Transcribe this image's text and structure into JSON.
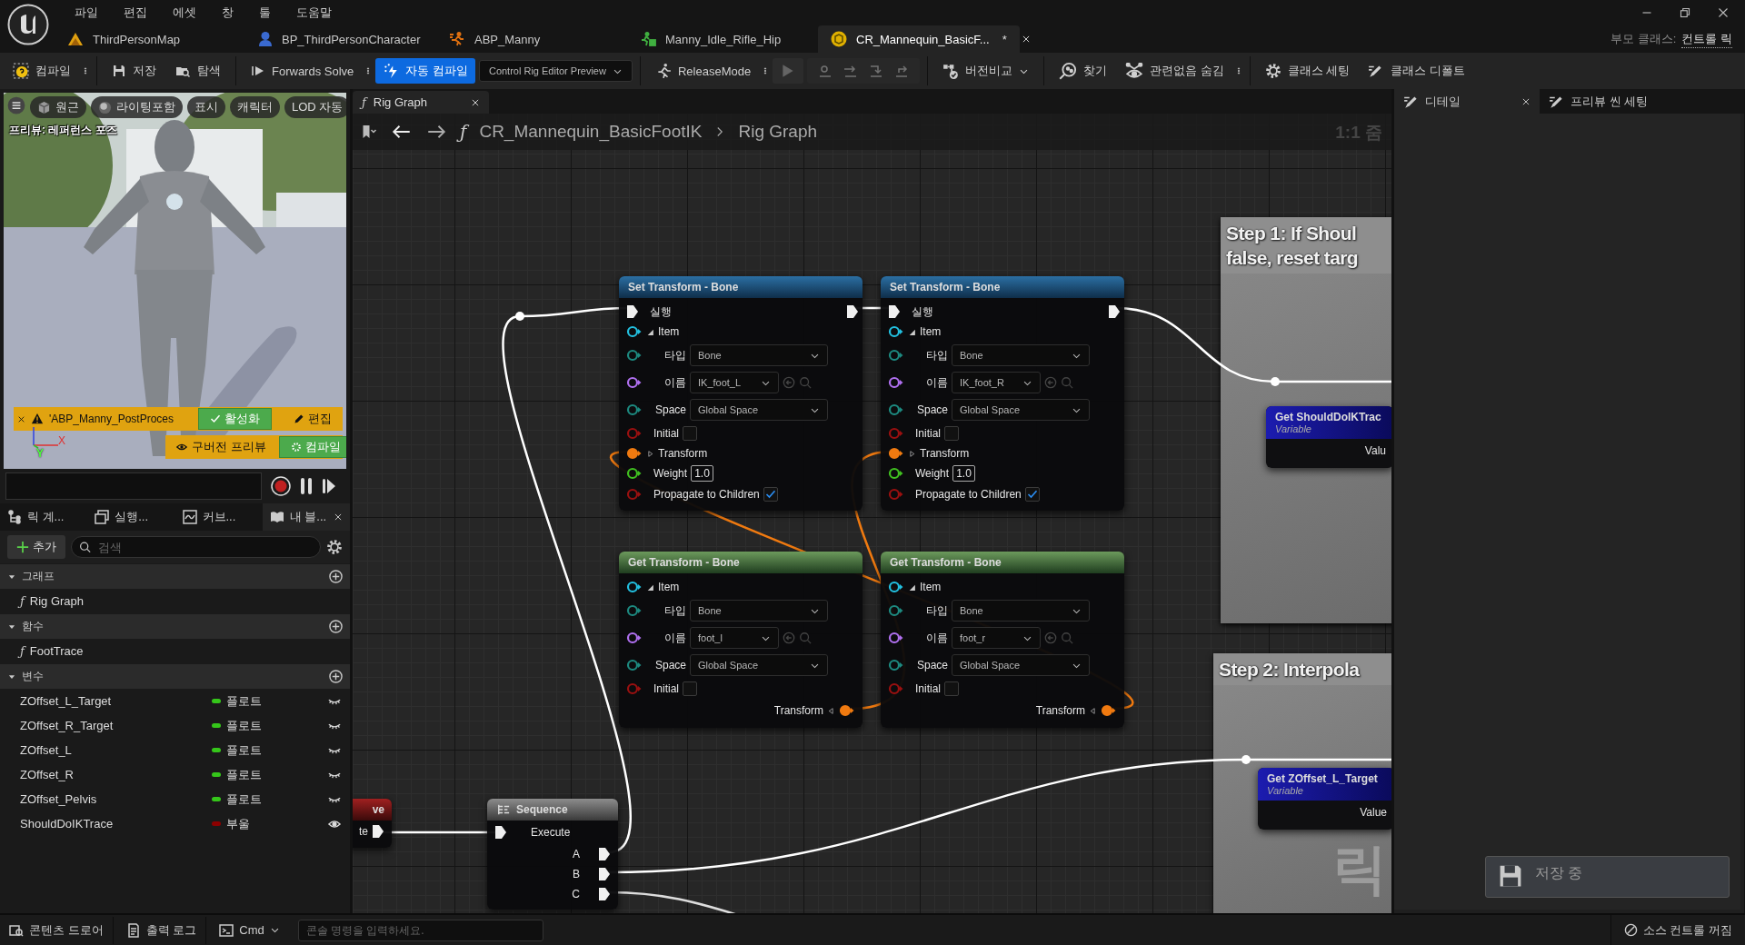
{
  "menu": [
    "파일",
    "편집",
    "에셋",
    "창",
    "툴",
    "도움말"
  ],
  "doc_tabs": [
    {
      "label": "ThirdPersonMap",
      "kind": "level",
      "selected": false,
      "closable": false
    },
    {
      "label": "BP_ThirdPersonCharacter",
      "kind": "blueprint",
      "selected": false,
      "closable": false
    },
    {
      "label": "ABP_Manny",
      "kind": "anim",
      "selected": false,
      "closable": false
    },
    {
      "label": "Manny_Idle_Rifle_Hip",
      "kind": "sequence",
      "selected": false,
      "closable": false
    },
    {
      "label": "CR_Mannequin_BasicF...",
      "kind": "rig",
      "marker": "*",
      "selected": true,
      "closable": true
    }
  ],
  "parent_class": {
    "label": "부모 클래스:",
    "value": "컨트롤 릭"
  },
  "toolbar": [
    {
      "kind": "button",
      "label": "컴파일"
    },
    {
      "kind": "more"
    },
    {
      "kind": "separator"
    },
    {
      "kind": "button",
      "label": "저장"
    },
    {
      "kind": "button",
      "label": "탐색"
    },
    {
      "kind": "separator"
    },
    {
      "kind": "button",
      "label": "Forwards Solve"
    },
    {
      "kind": "more"
    },
    {
      "kind": "toggle",
      "label": "자동 컴파일",
      "on": true
    },
    {
      "kind": "dropdown",
      "label": "Control Rig Editor Preview"
    },
    {
      "kind": "separator"
    },
    {
      "kind": "button",
      "label": "ReleaseMode"
    },
    {
      "kind": "more"
    },
    {
      "kind": "play",
      "disabled": true
    },
    {
      "kind": "steps",
      "disabled": true
    },
    {
      "kind": "separator"
    },
    {
      "kind": "dropdown",
      "label": "버전비교"
    },
    {
      "kind": "separator"
    },
    {
      "kind": "button",
      "label": "찾기"
    },
    {
      "kind": "button",
      "label": "관련없음 숨김"
    },
    {
      "kind": "more"
    },
    {
      "kind": "separator"
    },
    {
      "kind": "button",
      "label": "클래스 세팅"
    },
    {
      "kind": "button",
      "label": "클래스 디폴트"
    }
  ],
  "viewport": {
    "toolbar": [
      {
        "label": "원근"
      },
      {
        "label": "라이팅포함"
      },
      {
        "label": "표시"
      },
      {
        "label": "캐릭터"
      },
      {
        "label": "LOD 자동"
      }
    ],
    "caption": "프리뷰: 레퍼런스 포즈",
    "warning": {
      "text": "'ABP_Manny_PostProces",
      "enable": "활성화",
      "edit": "편집"
    },
    "legacy": {
      "label": "구버전 프리뷰",
      "compile": "컴파일"
    },
    "axes": [
      "X",
      "Y"
    ]
  },
  "blueprint": {
    "tabs": [
      {
        "label": "릭 계...",
        "selected": false
      },
      {
        "label": "실행...",
        "selected": false
      },
      {
        "label": "커브...",
        "selected": false
      },
      {
        "label": "내 블...",
        "selected": true
      }
    ],
    "add": "추가",
    "search": {
      "placeholder": "검색"
    },
    "sections": [
      {
        "title": "그래프",
        "expanded": true,
        "items": [
          {
            "glyph": "ƒ",
            "label": "Rig Graph"
          }
        ]
      },
      {
        "title": "함수",
        "expanded": true,
        "items": [
          {
            "glyph": "ƒ",
            "label": "FootTrace"
          }
        ]
      },
      {
        "title": "변수",
        "expanded": true,
        "items": [
          {
            "label": "ZOffset_L_Target",
            "type": "플로트",
            "color": "#35c61a",
            "exposed": false
          },
          {
            "label": "ZOffset_R_Target",
            "type": "플로트",
            "color": "#35c61a",
            "exposed": false
          },
          {
            "label": "ZOffset_L",
            "type": "플로트",
            "color": "#35c61a",
            "exposed": false
          },
          {
            "label": "ZOffset_R",
            "type": "플로트",
            "color": "#35c61a",
            "exposed": false
          },
          {
            "label": "ZOffset_Pelvis",
            "type": "플로트",
            "color": "#35c61a",
            "exposed": false
          },
          {
            "label": "ShouldDoIKTrace",
            "type": "부울",
            "color": "#8c0000",
            "exposed": true
          }
        ]
      }
    ]
  },
  "graph": {
    "tab": {
      "glyph": "ƒ",
      "label": "Rig Graph"
    },
    "breadcrumb": {
      "glyph": "ƒ",
      "path": [
        "CR_Mannequin_BasicFootIK",
        "Rig Graph"
      ]
    },
    "zoom": "1:1 줌",
    "comments": [
      {
        "lines": [
          "Step 1: If Shoul",
          "false, reset targ"
        ]
      },
      {
        "lines": [
          "Step 2: Interpola"
        ]
      }
    ],
    "corner_label": "릭",
    "nodes": [
      {
        "kind": "set",
        "title": "Set Transform - Bone",
        "exec": "실행",
        "item": "Item",
        "type_label": "타입",
        "type": "Bone",
        "name_label": "이름",
        "name": "IK_foot_L",
        "space_label": "Space",
        "space": "Global Space",
        "initial_label": "Initial",
        "initial": false,
        "transform": "Transform",
        "weight_label": "Weight",
        "weight": "1.0",
        "propagate_label": "Propagate to Children",
        "propagate": true
      },
      {
        "kind": "set",
        "title": "Set Transform - Bone",
        "exec": "실행",
        "item": "Item",
        "type_label": "타입",
        "type": "Bone",
        "name_label": "이름",
        "name": "IK_foot_R",
        "space_label": "Space",
        "space": "Global Space",
        "initial_label": "Initial",
        "initial": false,
        "transform": "Transform",
        "weight_label": "Weight",
        "weight": "1.0",
        "propagate_label": "Propagate to Children",
        "propagate": true
      },
      {
        "kind": "get",
        "title": "Get Transform - Bone",
        "item": "Item",
        "type_label": "타입",
        "type": "Bone",
        "name_label": "이름",
        "name": "foot_l",
        "space_label": "Space",
        "space": "Global Space",
        "initial_label": "Initial",
        "initial": false,
        "transform": "Transform"
      },
      {
        "kind": "get",
        "title": "Get Transform - Bone",
        "item": "Item",
        "type_label": "타입",
        "type": "Bone",
        "name_label": "이름",
        "name": "foot_r",
        "space_label": "Space",
        "space": "Global Space",
        "initial_label": "Initial",
        "initial": false,
        "transform": "Transform"
      },
      {
        "kind": "event",
        "title": "ve",
        "output": "te"
      },
      {
        "kind": "sequence",
        "title": "Sequence",
        "input": "Execute",
        "outputs": [
          "A",
          "B",
          "C"
        ]
      },
      {
        "kind": "variable",
        "title": "Get ShouldDoIKTrac",
        "subtitle": "Variable",
        "output": "Valu"
      },
      {
        "kind": "variable",
        "title": "Get ZOffset_L_Target",
        "subtitle": "Variable",
        "output": "Value"
      }
    ]
  },
  "details": {
    "tabs": [
      {
        "label": "디테일",
        "selected": true,
        "closable": true
      },
      {
        "label": "프리뷰 씬 세팅",
        "selected": false,
        "closable": false
      }
    ]
  },
  "toast": {
    "label": "저장 중"
  },
  "status_bar": {
    "items": [
      {
        "label": "콘텐츠 드로어"
      },
      {
        "label": "출력 로그"
      }
    ],
    "cmd": "Cmd",
    "console": {
      "placeholder": "콘솔 명령을 입력하세요."
    },
    "source_control": "소스 컨트롤 꺼짐"
  }
}
